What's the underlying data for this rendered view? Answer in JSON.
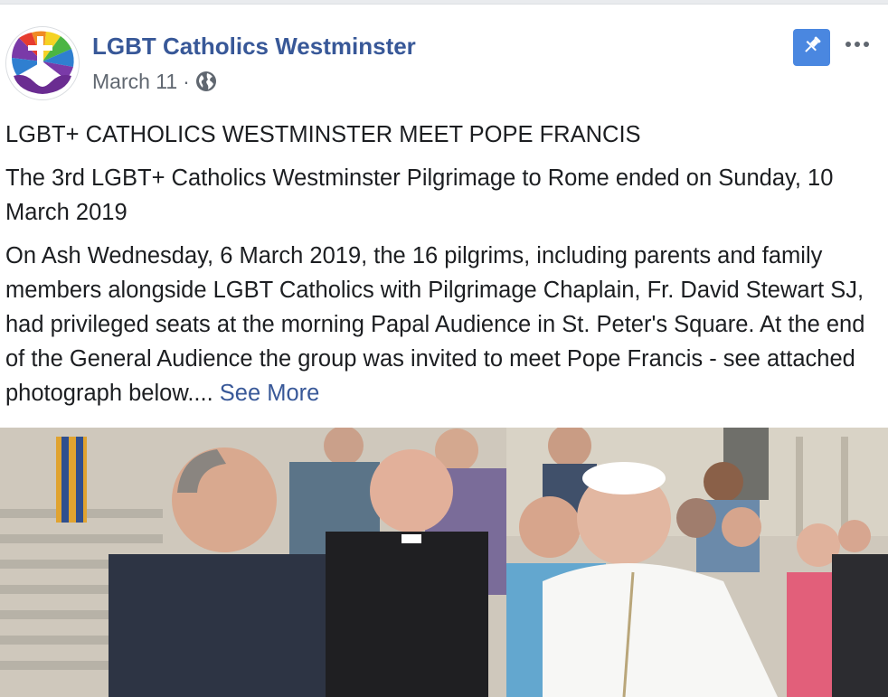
{
  "post": {
    "page_name": "LGBT Catholics Westminster",
    "date": "March 11",
    "separator": "·",
    "title": "LGBT+ CATHOLICS WESTMINSTER MEET POPE FRANCIS",
    "paragraph_1": "The 3rd LGBT+ Catholics Westminster Pilgrimage to Rome ended on Sunday, 10 March 2019",
    "paragraph_2": "On Ash Wednesday, 6 March 2019, the 16 pilgrims, including parents and family members alongside LGBT Catholics with Pilgrimage Chaplain, Fr. David Stewart SJ, had privileged seats at the morning Papal Audience in St. Peter's Square. At the end of the General Audience the group was invited to meet Pope Francis - see attached photograph below....",
    "see_more": "See More"
  },
  "icons": {
    "avatar": "rainbow-cross-hands-logo",
    "audience": "globe-icon",
    "pin": "pin-icon",
    "more": "more-options-icon"
  },
  "colors": {
    "link": "#385898",
    "pin_button": "#4a87e0",
    "text": "#1c1e21",
    "meta": "#606770"
  }
}
